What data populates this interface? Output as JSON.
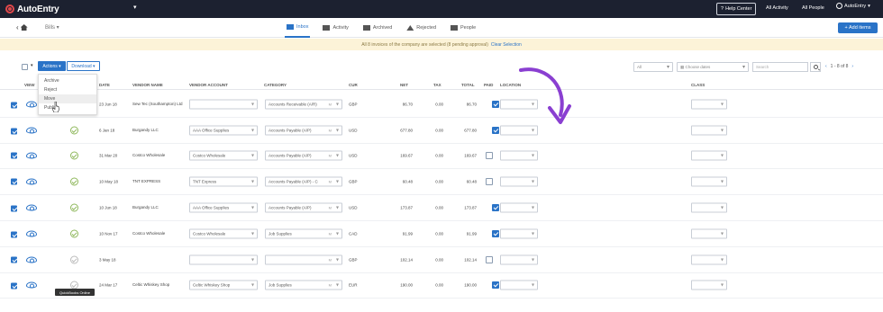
{
  "topbar": {
    "app_name": "AutoEntry",
    "help": "Help Center",
    "all_activity": "All Activity",
    "all_people": "All People",
    "user": "AutoEntry"
  },
  "subnav": {
    "bills": "Bills",
    "tabs": [
      {
        "label": "Inbox",
        "active": true,
        "icon": "inbox-icon"
      },
      {
        "label": "Activity",
        "active": false,
        "icon": "activity-icon"
      },
      {
        "label": "Archived",
        "active": false,
        "icon": "archive-icon"
      },
      {
        "label": "Rejected",
        "active": false,
        "icon": "warning-icon"
      },
      {
        "label": "People",
        "active": false,
        "icon": "people-icon"
      }
    ],
    "add_items": "+ Add items"
  },
  "notice": {
    "text": "All 8 invoices of the company are selected (8 pending approval)",
    "clear": "Clear Selection"
  },
  "toolbar": {
    "actions": "Actions ▾",
    "download": "Download ▾",
    "filter_all": "All",
    "date_placeholder": "Choose dates",
    "search_placeholder": "Search",
    "pager": "1 - 8 of 8"
  },
  "actions_menu": [
    "Archive",
    "Reject",
    "Move",
    "Publish"
  ],
  "columns": {
    "view": "VIEW",
    "date": "DATE",
    "vendor_name": "VENDOR NAME",
    "vendor_account": "VENDOR ACCOUNT",
    "category": "CATEGORY",
    "cur": "CUR",
    "net": "NET",
    "tax": "TAX",
    "total": "TOTAL",
    "paid": "PAID",
    "location": "LOCATION",
    "class": "CLASS"
  },
  "rows": [
    {
      "date": "23 Jun 18",
      "vendor": "Sew Tec (Southampton) Ltd",
      "account": "",
      "category": "Accounts Receivable (A/R)",
      "cur": "GBP",
      "net": "86.70",
      "tax": "0.00",
      "total": "86.70",
      "paid": true,
      "status": "none"
    },
    {
      "date": "6 Jan 18",
      "vendor": "Burgandy LLC",
      "account": "AAA Office Supplies",
      "category": "Accounts Payable (A/P)",
      "cur": "USD",
      "net": "677.80",
      "tax": "0.00",
      "total": "677.80",
      "paid": true,
      "status": "ok"
    },
    {
      "date": "31 Mar 20",
      "vendor": "Costco Wholesale",
      "account": "Costco Wholesale",
      "category": "Accounts Payable (A/P)",
      "cur": "USD",
      "net": "169.67",
      "tax": "0.00",
      "total": "169.67",
      "paid": false,
      "status": "ok"
    },
    {
      "date": "10 May 18",
      "vendor": "TNT EXPRESS",
      "account": "TNT Express",
      "category": "Accounts Payable (A/P) - C",
      "cur": "GBP",
      "net": "60.48",
      "tax": "0.00",
      "total": "60.48",
      "paid": false,
      "status": "ok"
    },
    {
      "date": "10 Jun 18",
      "vendor": "Burgandy LLC",
      "account": "AAA Office Supplies",
      "category": "Accounts Payable (A/P)",
      "cur": "USD",
      "net": "173.87",
      "tax": "0.00",
      "total": "173.87",
      "paid": true,
      "status": "ok"
    },
    {
      "date": "10 Nov 17",
      "vendor": "Costco Wholesale",
      "account": "Costco Wholesale",
      "category": "Job Supplies",
      "cur": "CAD",
      "net": "91.99",
      "tax": "0.00",
      "total": "91.99",
      "paid": true,
      "status": "ok"
    },
    {
      "date": "3 May 18",
      "vendor": "",
      "account": "",
      "category": "",
      "cur": "GBP",
      "net": "102.14",
      "tax": "0.00",
      "total": "102.14",
      "paid": false,
      "status": "gray"
    },
    {
      "date": "24 Mar 17",
      "vendor": "Celtic Whiskey Shop",
      "account": "Celtic Whiskey Shop",
      "category": "Job Supplies",
      "cur": "EUR",
      "net": "190.00",
      "tax": "0.00",
      "total": "190.00",
      "paid": true,
      "status": "gray"
    }
  ],
  "tooltip": "QuickBooks Online",
  "colors": {
    "accent": "#2a73c7",
    "topbar": "#1c2130",
    "annotation_arrow": "#8a3fd1"
  }
}
